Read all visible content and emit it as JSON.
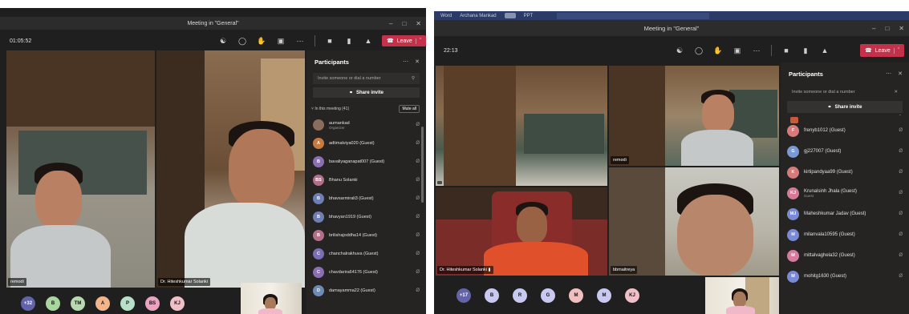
{
  "left": {
    "window_title": "Meeting in \"General\"",
    "timer": "01:05:52",
    "leave_label": "Leave",
    "panel": {
      "title": "Participants",
      "invite_placeholder": "Invite someone or dial a number",
      "share_label": "Share invite",
      "in_meeting_label": "In this meeting (41)",
      "mute_all_label": "Mute all",
      "participants": [
        {
          "initials": "",
          "name": "aumankad",
          "sub": "Organizer",
          "color": "#8a6d5c"
        },
        {
          "initials": "A",
          "name": "adtimalviya020 (Guest)",
          "sub": "",
          "color": "#c97a3e"
        },
        {
          "initials": "B",
          "name": "bavaliyaganapat007 (Guest)",
          "sub": "",
          "color": "#8b6fb3"
        },
        {
          "initials": "BS",
          "name": "Bhanu Solanki",
          "sub": "",
          "color": "#b36f8a"
        },
        {
          "initials": "B",
          "name": "bhavsarmirali3 (Guest)",
          "sub": "",
          "color": "#6f7fb3"
        },
        {
          "initials": "B",
          "name": "bhavyan1919 (Guest)",
          "sub": "",
          "color": "#6f7fb3"
        },
        {
          "initials": "B",
          "name": "brilishajoddha14 (Guest)",
          "sub": "",
          "color": "#b36f8a"
        },
        {
          "initials": "C",
          "name": "chanchalrakhuva (Guest)",
          "sub": "",
          "color": "#7a6fb3"
        },
        {
          "initials": "C",
          "name": "chavdarira64176 (Guest)",
          "sub": "",
          "color": "#8a6fb3"
        },
        {
          "initials": "D",
          "name": "damayamma22 (Guest)",
          "sub": "",
          "color": "#6f8ab3"
        }
      ]
    },
    "videos": {
      "tile1_label": "remodi",
      "tile2_label": "Dr. Hiteshkumar Solanki"
    },
    "bottom_avatars": [
      {
        "initials": "+32",
        "color": "#6264a7"
      },
      {
        "initials": "B",
        "color": "#a8d5a0"
      },
      {
        "initials": "TM",
        "color": "#b8d8b0"
      },
      {
        "initials": "A",
        "color": "#f2b48a"
      },
      {
        "initials": "P",
        "color": "#b8e0c8"
      },
      {
        "initials": "BS",
        "color": "#e8a4c0"
      },
      {
        "initials": "KJ",
        "color": "#f0c0c8"
      }
    ]
  },
  "right": {
    "os_tabs": [
      "Word",
      "Archana Mankad",
      "PPT"
    ],
    "window_title": "Meeting in \"General\"",
    "timer": "22:13",
    "leave_label": "Leave",
    "panel": {
      "title": "Participants",
      "invite_placeholder": "Invite someone or dial a number",
      "share_label": "Share invite",
      "participants": [
        {
          "initials": "F",
          "name": "frenyb1012 (Guest)",
          "sub": "",
          "color": "#d67a7a"
        },
        {
          "initials": "G",
          "name": "gj227007 (Guest)",
          "sub": "",
          "color": "#7a9ad6"
        },
        {
          "initials": "K",
          "name": "kirtipandyaa99 (Guest)",
          "sub": "",
          "color": "#d67a7a"
        },
        {
          "initials": "KJ",
          "name": "Krunalsinh Jhala (Guest)",
          "sub": "Guest",
          "color": "#d67a9a"
        },
        {
          "initials": "MJ",
          "name": "Maheshkumar Jadav (Guest)",
          "sub": "",
          "color": "#7a8ad6"
        },
        {
          "initials": "M",
          "name": "milanvala10595 (Guest)",
          "sub": "",
          "color": "#7a8ad6"
        },
        {
          "initials": "M",
          "name": "mittalvaghela32 (Guest)",
          "sub": "",
          "color": "#d67aa0"
        },
        {
          "initials": "M",
          "name": "mohitg1630 (Guest)",
          "sub": "",
          "color": "#7a8ad6"
        }
      ]
    },
    "videos": {
      "tile1_label": "",
      "tile2_label": "remodi",
      "tile3_label": "Dr. Hiteshkumar Solanki",
      "tile4_label": "bbmaitreya"
    },
    "bottom_avatars": [
      {
        "initials": "+17",
        "color": "#6264a7"
      },
      {
        "initials": "B",
        "color": "#c8c8f0"
      },
      {
        "initials": "R",
        "color": "#c8c8f0"
      },
      {
        "initials": "G",
        "color": "#c8c8f0"
      },
      {
        "initials": "M",
        "color": "#f0c0c0"
      },
      {
        "initials": "M",
        "color": "#c8c8f0"
      },
      {
        "initials": "KJ",
        "color": "#f0c0c8"
      }
    ]
  }
}
